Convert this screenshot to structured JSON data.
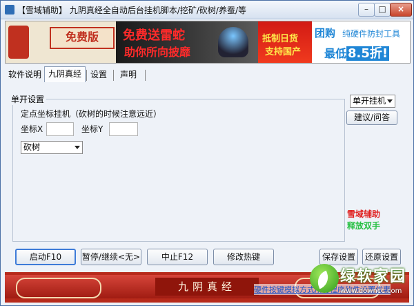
{
  "window": {
    "title": "【雪域辅助】 九阴真经全自动后台挂机脚本/挖矿/砍树/养蚕/等",
    "min_label": "–",
    "max_label": "□",
    "close_label": "×"
  },
  "banner": {
    "free_label": "免费版",
    "promo1_line1": "免费送雷蛇",
    "promo1_line2": "助你所向披靡",
    "flag_line1": "抵制日货",
    "flag_line2": "支持国产",
    "groupbuy_title": "团购",
    "groupbuy_sub": "纯硬件防封工具",
    "groupbuy_price_prefix": "最低",
    "groupbuy_price": "8.5折!"
  },
  "tabs": [
    {
      "label": "软件说明"
    },
    {
      "label": "九阴真经"
    },
    {
      "label": "设置"
    },
    {
      "label": "声明"
    }
  ],
  "settings": {
    "group_title": "单开设置",
    "fixed_point_label": "定点坐标挂机（砍树的时候注意远近）",
    "coord_x_label": "坐标X",
    "coord_x_value": "",
    "coord_y_label": "坐标Y",
    "coord_y_value": "",
    "action_select": "砍树"
  },
  "side": {
    "mode_select": "单开挂机",
    "feedback_button": "建议/问答",
    "status_red": "雪域辅助",
    "status_green": "释放双手"
  },
  "buttons": {
    "start": "启动F10",
    "pause": "暂停/继续<无>",
    "stop": "中止F12",
    "hotkey": "修改热键",
    "save": "保存设置",
    "restore": "还原设置"
  },
  "footer": {
    "title": "九阴真经",
    "link": "硬件按键模拟方式所有程序软件设置优惠",
    "watermark": "绿软家园",
    "watermark_url": "www.downcc.com"
  },
  "colors": {
    "accent_blue": "#3d7bd8",
    "status_red": "#e02020",
    "status_green": "#27c043",
    "footer_red": "#b72a1b"
  }
}
